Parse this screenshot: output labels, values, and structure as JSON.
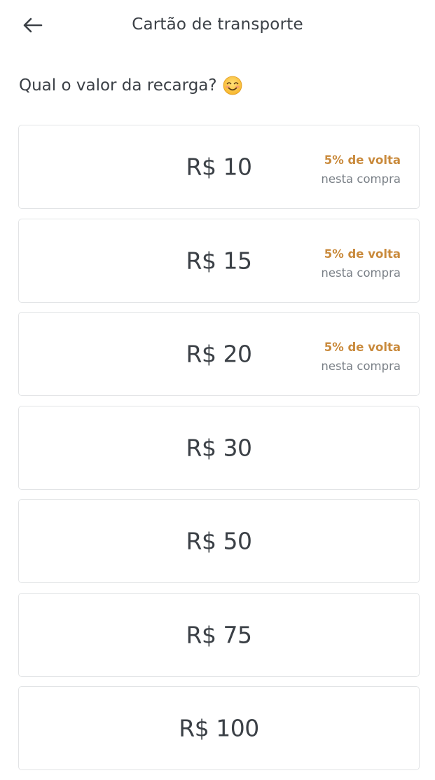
{
  "header": {
    "title": "Cartão de transporte",
    "back_icon": "arrow-left-icon"
  },
  "question": {
    "text": "Qual o valor da recarga?",
    "emoji_icon": "smiling-face-icon"
  },
  "options": [
    {
      "amount": "R$ 10",
      "cashback_main": "5% de volta",
      "cashback_sub": "nesta compra"
    },
    {
      "amount": "R$ 15",
      "cashback_main": "5% de volta",
      "cashback_sub": "nesta compra"
    },
    {
      "amount": "R$ 20",
      "cashback_main": "5% de volta",
      "cashback_sub": "nesta compra"
    },
    {
      "amount": "R$ 30"
    },
    {
      "amount": "R$ 50"
    },
    {
      "amount": "R$ 75"
    },
    {
      "amount": "R$ 100"
    }
  ],
  "colors": {
    "cashback_accent": "#c98a3c",
    "text_primary": "#3b4046",
    "text_secondary": "#7a8087",
    "card_border": "#e2e4e6"
  }
}
